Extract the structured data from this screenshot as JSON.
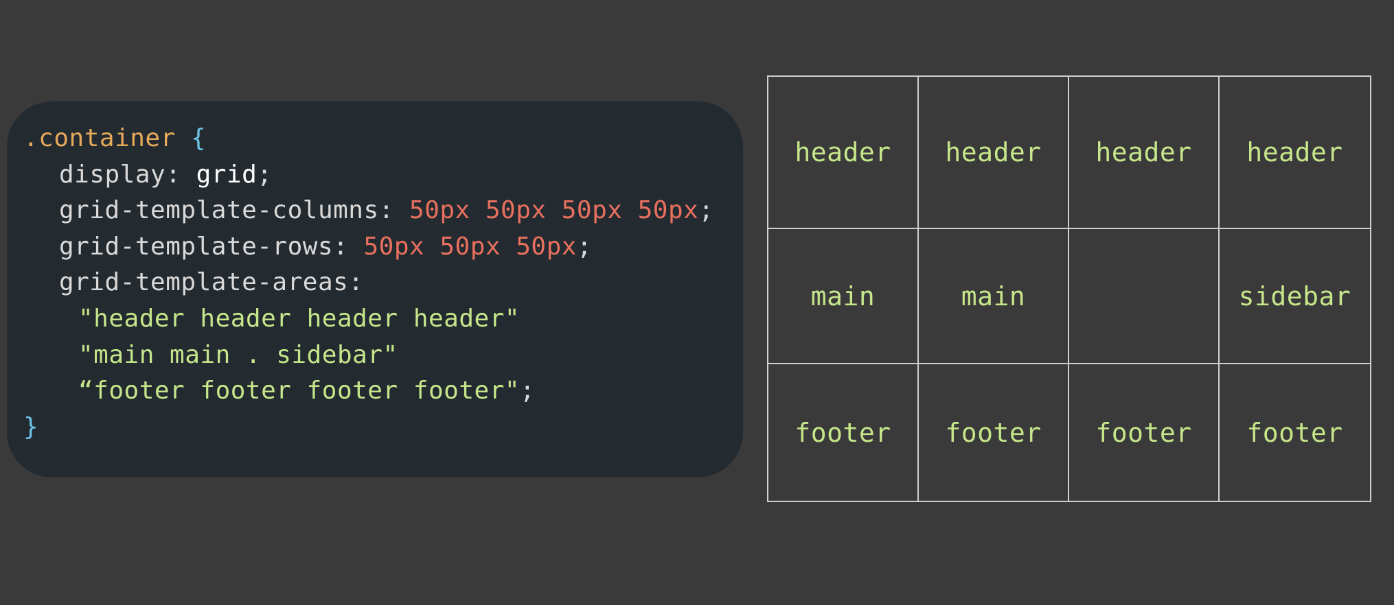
{
  "code": {
    "selector": ".container",
    "open_brace": "{",
    "close_brace": "}",
    "display_prop": "display",
    "display_value": "grid",
    "columns_prop": "grid-template-columns",
    "columns_value": "50px 50px 50px 50px",
    "rows_prop": "grid-template-rows",
    "rows_value": "50px 50px 50px",
    "areas_prop": "grid-template-areas",
    "areas_row1": "\"header header header header\"",
    "areas_row2": "\"main main . sidebar\"",
    "areas_row3": "“footer footer footer footer\""
  },
  "grid": {
    "cells": [
      "header",
      "header",
      "header",
      "header",
      "main",
      "main",
      "",
      "sidebar",
      "footer",
      "footer",
      "footer",
      "footer"
    ]
  }
}
